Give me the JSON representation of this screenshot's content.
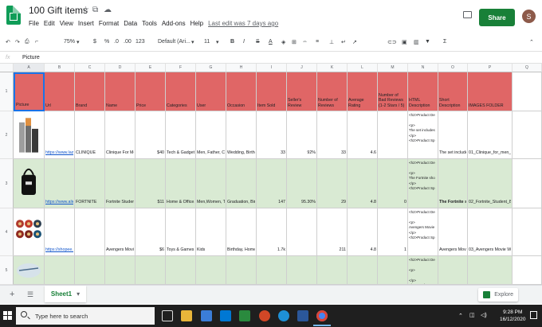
{
  "app": {
    "doc_title": "100 Gift items",
    "menu": [
      "File",
      "Edit",
      "View",
      "Insert",
      "Format",
      "Data",
      "Tools",
      "Add-ons",
      "Help"
    ],
    "last_edit": "Last edit was 7 days ago",
    "share_label": "Share",
    "avatar_letter": "S"
  },
  "toolbar": {
    "zoom": "75%",
    "currency": "$",
    "percent": "%",
    "dec0": ".0",
    "dec00": ".00",
    "number_format": "123",
    "font": "Default (Ari...",
    "font_size": "11",
    "bold": "B",
    "italic": "I",
    "strike": "S",
    "text_color": "A"
  },
  "formula": {
    "fx": "fx",
    "value": "Picture"
  },
  "columns": [
    "A",
    "B",
    "C",
    "D",
    "E",
    "F",
    "G",
    "H",
    "I",
    "J",
    "K",
    "L",
    "M",
    "N",
    "O",
    "P",
    "Q"
  ],
  "header_row": {
    "number": "1",
    "cells": [
      "Picture",
      "Url",
      "Brand",
      "Name",
      "Price",
      "Categories",
      "User",
      "Occasion",
      "Item Sold",
      "Seller's Review",
      "Number of Reviews",
      "Average Rating",
      "Number of Bad Reviews (1-2 Stars / 5)",
      "HTML Description",
      "Short Description",
      "IMAGES FOLDER"
    ]
  },
  "rows": [
    {
      "number": "2",
      "url": "https://www.laza",
      "brand": "CLINIQUE",
      "name": "Clinique For Me",
      "price": "$40",
      "categories": "Tech & Gadgets",
      "user": "Men, Father, Co",
      "occasion": "Wedding, Birthd",
      "sold": "33",
      "review": "92%",
      "num_reviews": "33",
      "rating": "4.6",
      "bad": "",
      "html": [
        "<h2>Product De",
        "",
        "<p>",
        "The set includes",
        "</p>",
        "<h2>Product Sp"
      ],
      "short": "The set includes",
      "folder": "01_Clinique_for_men_h"
    },
    {
      "number": "3",
      "url": "https://www.alies",
      "brand": "FORTNITE",
      "name": "Fortnite Student",
      "price": "$11",
      "categories": "Home & Office,",
      "user": "Men,Women, Te",
      "occasion": "Graduation, Birth",
      "sold": "147",
      "review": "95.30%",
      "num_reviews": "29",
      "rating": "4.8",
      "bad": "0",
      "html": [
        "<h2>Product De",
        "",
        "<p>",
        "The Fortnite sho",
        "</p>",
        "<h2>Product Sp"
      ],
      "short": "The Fortnite st",
      "folder": "02_Fortnite_Student_Ba"
    },
    {
      "number": "4",
      "url": "https://shopee.sg",
      "brand": "",
      "name": "Avengers Movie",
      "price": "$6",
      "categories": "Toys & Games",
      "user": "Kids",
      "occasion": "Birthday, Home",
      "sold": "1.7k",
      "review": "",
      "num_reviews": "211",
      "rating": "4.8",
      "bad": "1",
      "html": [
        "<h2>Product De",
        "",
        "<p>",
        "Avengers Movie",
        "</p>",
        "<h2>Product Sp"
      ],
      "short": "Avengers Movie",
      "folder": "03_Avengers Movie Wa"
    },
    {
      "number": "5",
      "html": [
        "<h2>Product De",
        "",
        "<p>",
        "",
        "</p>",
        "<h2>Product Sp"
      ]
    }
  ],
  "sheet": {
    "tab": "Sheet1",
    "explore": "Explore"
  },
  "taskbar": {
    "search_placeholder": "Type here to search",
    "time": "9:28 PM",
    "date": "16/12/2020"
  },
  "colors": {
    "header_fill": "#e06666",
    "green_fill": "#d9ead3",
    "accent": "#188038"
  }
}
